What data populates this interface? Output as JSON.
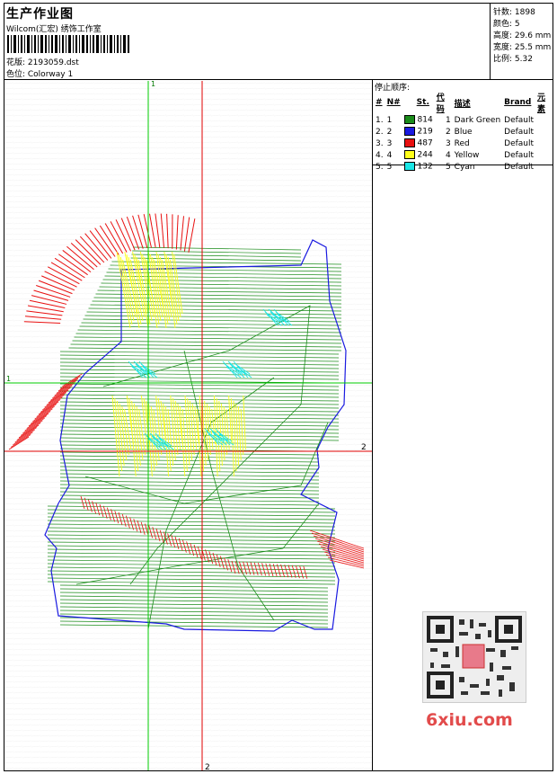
{
  "header": {
    "title": "生产作业图",
    "company": "Wilcom(汇宏) 绣饰工作室",
    "design_label": "花版: 2193059.dst",
    "colorway_label": "色位: Colorway 1"
  },
  "stats": [
    "针数: 1898",
    "颜色: 5",
    "高度: 29.6 mm",
    "宽度: 25.5 mm",
    "比例: 5.32"
  ],
  "legend": {
    "title": "停止顺序:",
    "headers": [
      "#",
      "N#",
      "St.",
      "代码",
      "描述",
      "Brand",
      "元素"
    ],
    "rows": [
      {
        "num": "1.",
        "n": "1",
        "color": "#1a8c1a",
        "st": "814",
        "code": "1",
        "desc": "Dark Green",
        "brand": "Default"
      },
      {
        "num": "2.",
        "n": "2",
        "color": "#1a1ae0",
        "st": "219",
        "code": "2",
        "desc": "Blue",
        "brand": "Default"
      },
      {
        "num": "3.",
        "n": "3",
        "color": "#e81010",
        "st": "487",
        "code": "3",
        "desc": "Red",
        "brand": "Default"
      },
      {
        "num": "4.",
        "n": "4",
        "color": "#ffff1a",
        "st": "244",
        "code": "4",
        "desc": "Yellow",
        "brand": "Default"
      },
      {
        "num": "5.",
        "n": "5",
        "color": "#1ae6e6",
        "st": "132",
        "code": "5",
        "desc": "Cyan",
        "brand": "Default"
      }
    ]
  },
  "axes": {
    "green_top": "1",
    "green_left": "1",
    "red_right": "2",
    "red_bottom": "2",
    "green_color": "#00cc00",
    "red_color": "#e00000"
  },
  "watermark": "6xiu.com"
}
